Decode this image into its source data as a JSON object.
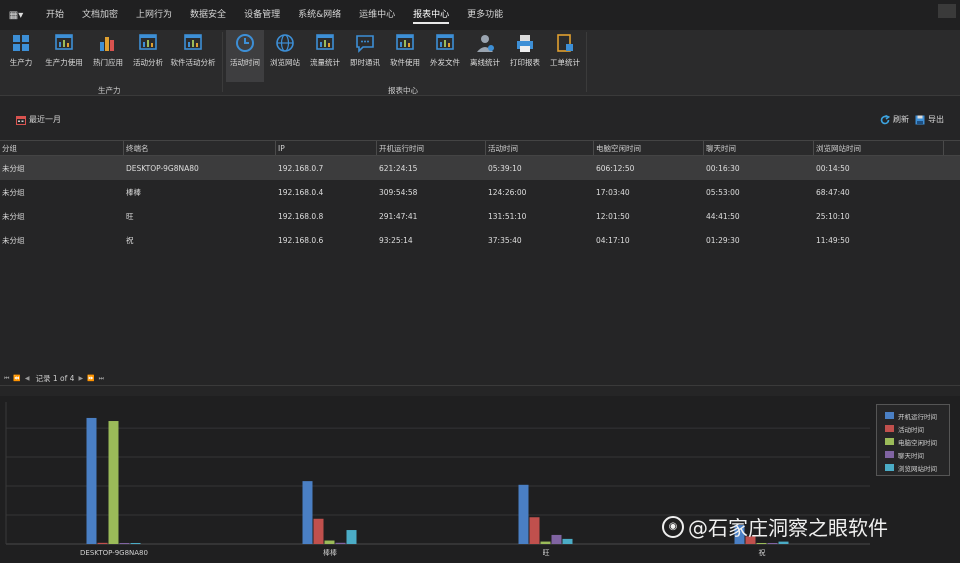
{
  "menubar": {
    "app_icon": "grid-menu-icon",
    "items": [
      "开始",
      "文档加密",
      "上网行为",
      "数据安全",
      "设备管理",
      "系统&网络",
      "运维中心",
      "报表中心",
      "更多功能"
    ],
    "active_index": 7
  },
  "ribbon": {
    "buttons": [
      {
        "label": "生产力",
        "icon": "productivity-icon",
        "color": "#3d8fd6"
      },
      {
        "label": "生产力使用",
        "icon": "doc-chart-icon",
        "color": "#3d8fd6"
      },
      {
        "label": "热门应用",
        "icon": "bar-blocks-icon",
        "color": "#e0a030"
      },
      {
        "label": "活动分析",
        "icon": "window-star-icon",
        "color": "#3d8fd6"
      },
      {
        "label": "软件活动分析",
        "icon": "window-chart-icon",
        "color": "#3d8fd6"
      },
      {
        "label": "活动时间",
        "icon": "clock-icon",
        "color": "#3d8fd6"
      },
      {
        "label": "浏览网站",
        "icon": "globe-icon",
        "color": "#3d8fd6"
      },
      {
        "label": "流量统计",
        "icon": "traffic-chart-icon",
        "color": "#3d8fd6"
      },
      {
        "label": "即时通讯",
        "icon": "chat-icon",
        "color": "#3d8fd6"
      },
      {
        "label": "软件使用",
        "icon": "monitor-icon",
        "color": "#3d8fd6"
      },
      {
        "label": "外发文件",
        "icon": "file-send-icon",
        "color": "#3d8fd6"
      },
      {
        "label": "离线统计",
        "icon": "user-offline-icon",
        "color": "#3d8fd6"
      },
      {
        "label": "打印报表",
        "icon": "printer-icon",
        "color": "#3d8fd6"
      },
      {
        "label": "工单统计",
        "icon": "clipboard-lock-icon",
        "color": "#e0a030"
      }
    ],
    "active_index": 5,
    "groups": [
      "生产力",
      "报表中心"
    ]
  },
  "toolbar": {
    "range_label": "最近一月",
    "refresh_label": "刷新",
    "export_label": "导出"
  },
  "grid": {
    "columns": [
      "分组",
      "终端名",
      "IP",
      "开机运行时间",
      "活动时间",
      "电脑空闲时间",
      "聊天时间",
      "浏览网站时间"
    ],
    "rows": [
      [
        "未分组",
        "DESKTOP-9G8NA80",
        "192.168.0.7",
        "621:24:15",
        "05:39:10",
        "606:12:50",
        "00:16:30",
        "00:14:50"
      ],
      [
        "未分组",
        "棒棒",
        "192.168.0.4",
        "309:54:58",
        "124:26:00",
        "17:03:40",
        "05:53:00",
        "68:47:40"
      ],
      [
        "未分组",
        "旺",
        "192.168.0.8",
        "291:47:41",
        "131:51:10",
        "12:01:50",
        "44:41:50",
        "25:10:10"
      ],
      [
        "未分组",
        "祝",
        "192.168.0.6",
        "93:25:14",
        "37:35:40",
        "04:17:10",
        "01:29:30",
        "11:49:50"
      ]
    ],
    "selected_row": 0
  },
  "pager": {
    "text": "记录 1 of 4"
  },
  "chart_data": {
    "type": "bar",
    "categories": [
      "DESKTOP-9G8NA80",
      "棒棒",
      "旺",
      "祝"
    ],
    "series": [
      {
        "name": "开机运行时间",
        "color": "#4a7fc4",
        "values": [
          621.4,
          309.9,
          291.8,
          93.4
        ]
      },
      {
        "name": "活动时间",
        "color": "#c0504d",
        "values": [
          5.7,
          124.4,
          131.9,
          37.6
        ]
      },
      {
        "name": "电脑空闲时间",
        "color": "#9bbb59",
        "values": [
          606.2,
          17.1,
          12.0,
          4.3
        ]
      },
      {
        "name": "聊天时间",
        "color": "#8064a2",
        "values": [
          0.3,
          5.9,
          44.7,
          1.5
        ]
      },
      {
        "name": "浏览网站时间",
        "color": "#4bacc6",
        "values": [
          0.2,
          68.8,
          25.2,
          11.8
        ]
      }
    ],
    "ylim": [
      0,
      700
    ],
    "grid": true,
    "legend": "top-right"
  },
  "watermark": {
    "text": "@石家庄洞察之眼软件",
    "icon": "weibo-logo-icon"
  }
}
